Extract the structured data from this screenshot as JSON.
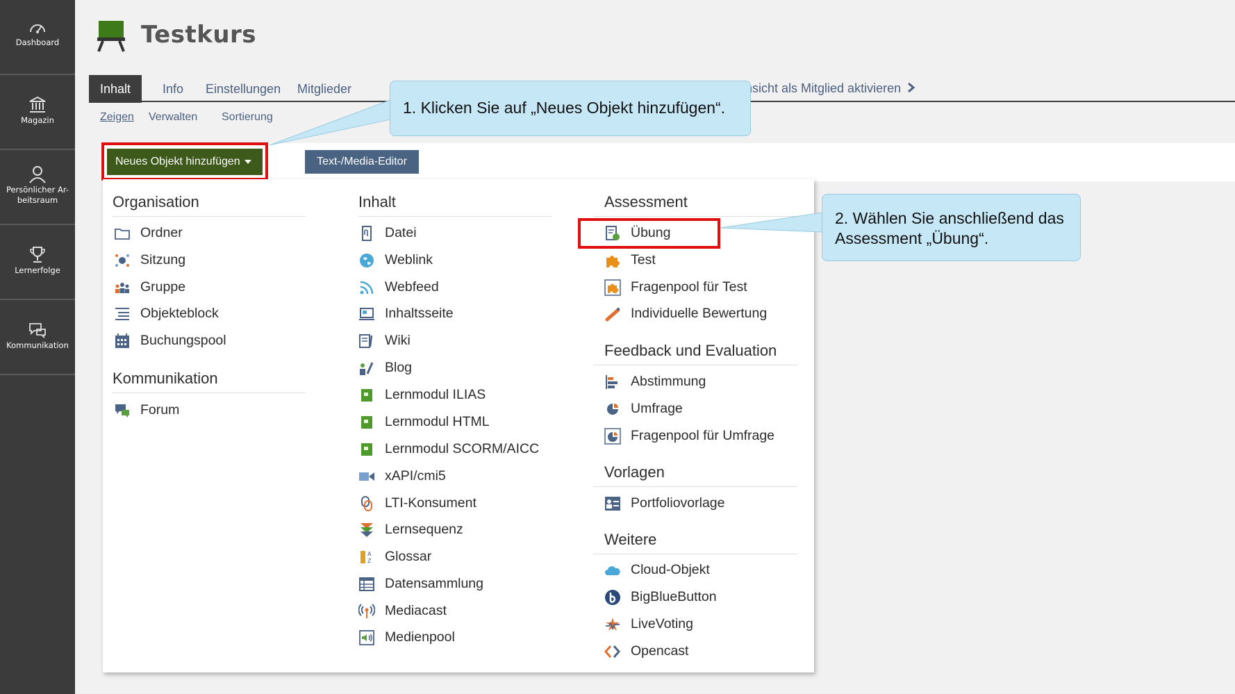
{
  "sidebar": {
    "items": [
      {
        "label": "Dashboard",
        "icon": "dashboard-icon"
      },
      {
        "label": "Magazin",
        "icon": "library-icon"
      },
      {
        "label": "Persönlicher Ar-beitsraum",
        "icon": "person-icon"
      },
      {
        "label": "Lernerfolge",
        "icon": "trophy-icon"
      },
      {
        "label": "Kommunikation",
        "icon": "chat-icon"
      }
    ]
  },
  "header": {
    "title": "Testkurs",
    "icon": "course-blackboard-icon"
  },
  "tabs": [
    {
      "label": "Inhalt",
      "active": true
    },
    {
      "label": "Info",
      "active": false
    },
    {
      "label": "Einstellungen",
      "active": false
    },
    {
      "label": "Mitglieder",
      "active": false
    }
  ],
  "member_view": {
    "label": "nsicht als Mitglied aktivieren"
  },
  "subtabs": [
    {
      "label": "Zeigen",
      "active": true
    },
    {
      "label": "Verwalten",
      "active": false
    },
    {
      "label": "Sortierung",
      "active": false
    }
  ],
  "toolbar": {
    "add_label": "Neues Objekt hinzufügen",
    "editor_label": "Text-/Media-Editor"
  },
  "menu": {
    "organisation": {
      "title": "Organisation",
      "items": [
        "Ordner",
        "Sitzung",
        "Gruppe",
        "Objekteblock",
        "Buchungspool"
      ]
    },
    "kommunikation": {
      "title": "Kommunikation",
      "items": [
        "Forum"
      ]
    },
    "inhalt": {
      "title": "Inhalt",
      "items": [
        "Datei",
        "Weblink",
        "Webfeed",
        "Inhaltsseite",
        "Wiki",
        "Blog",
        "Lernmodul ILIAS",
        "Lernmodul HTML",
        "Lernmodul SCORM/AICC",
        "xAPI/cmi5",
        "LTI-Konsument",
        "Lernsequenz",
        "Glossar",
        "Datensammlung",
        "Mediacast",
        "Medienpool"
      ]
    },
    "assessment": {
      "title": "Assessment",
      "items": [
        "Übung",
        "Test",
        "Fragenpool für Test",
        "Individuelle Bewertung"
      ]
    },
    "feedback": {
      "title": "Feedback und Evaluation",
      "items": [
        "Abstimmung",
        "Umfrage",
        "Fragenpool für Umfrage"
      ]
    },
    "vorlagen": {
      "title": "Vorlagen",
      "items": [
        "Portfoliovorlage"
      ]
    },
    "weitere": {
      "title": "Weitere",
      "items": [
        "Cloud-Objekt",
        "BigBlueButton",
        "LiveVoting",
        "Opencast"
      ]
    }
  },
  "callouts": {
    "step1": "1. Klicken Sie auf „Neues Objekt hinzufügen“.",
    "step2": "2. Wählen Sie anschließend das Assessment „Übung“."
  },
  "colors": {
    "sidebar": "#3b3b3b",
    "add_button": "#3d5a1a",
    "editor_button": "#4a6383",
    "highlight": "#e01010",
    "callout": "#c6e7f5",
    "link": "#4b5f80"
  }
}
